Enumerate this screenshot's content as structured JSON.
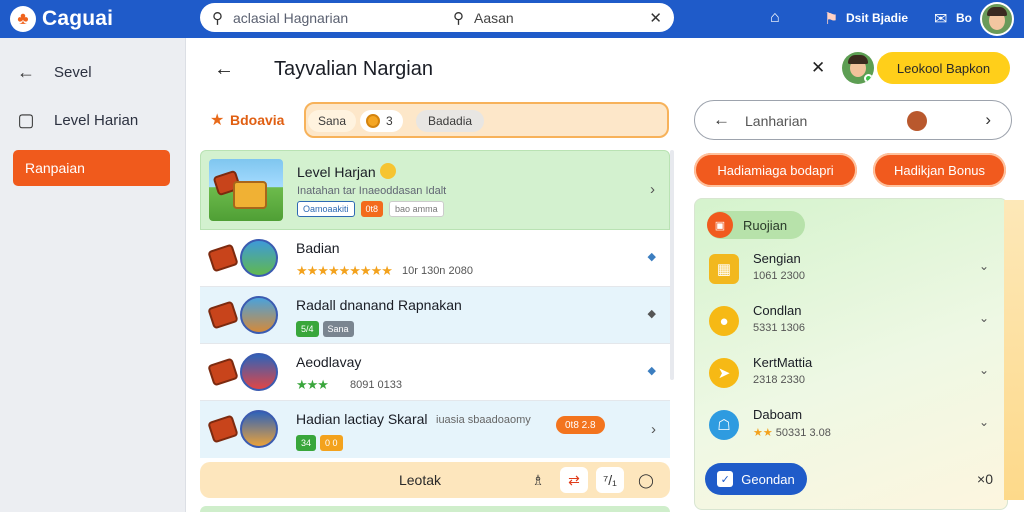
{
  "app": {
    "name": "Caguai",
    "logo_glyph": "♣"
  },
  "search": {
    "hint_left": "aclasial Hagnarian",
    "hint_right": "Aasan",
    "clear_glyph": "✕"
  },
  "topbar": {
    "user_label": "Dsit Bjadie",
    "notif_label": "Bo"
  },
  "sidebar": {
    "items": [
      {
        "label": "Sevel",
        "icon": "arrow-left-icon"
      },
      {
        "label": "Level Harian",
        "icon": "bag-icon"
      }
    ],
    "active": "Ranpaian"
  },
  "main": {
    "title": "Tayvalian Nargian",
    "primary_button": "Leokool Bapkon",
    "filter": {
      "label": "Bdoavia",
      "chips": [
        "Sana",
        "3",
        "Badadia"
      ]
    },
    "list": [
      {
        "title": "Level Harjan",
        "subtitle": "Inatahan tar Inaeoddasan Idalt",
        "tags": [
          "Oamoaakiti",
          "0t8",
          "bao amma"
        ]
      },
      {
        "title": "Badian",
        "rating": "★★★★★★★★★",
        "meta": "10r 130n 2080"
      },
      {
        "title": "Radall dnanand Rapnakan",
        "tags": [
          "5/4",
          "Sana"
        ]
      },
      {
        "title": "Aeodlavay",
        "rating": "★★★",
        "meta": "8091 0133"
      },
      {
        "title": "Hadian lactiay Skaral",
        "note": "iuasia sbaadoaomy",
        "tags": [
          "34",
          "0 0"
        ],
        "pill": "0t8 2.8"
      }
    ],
    "footer": {
      "label": "Leotak",
      "icons": [
        "♗",
        "⇄",
        "⁷/₁",
        "◯"
      ]
    }
  },
  "panel": {
    "search_label": "Lanharian",
    "buttons": [
      "Hadiamiaga bodapri",
      "Hadikjan Bonus"
    ],
    "card": {
      "header": "Ruojian",
      "items": [
        {
          "title": "Sengian",
          "sub": "1061 2300",
          "color": "#f2b81e",
          "icon": "chest-icon"
        },
        {
          "title": "Condlan",
          "sub": "5331 1306",
          "color": "#f6b915",
          "icon": "coin-icon"
        },
        {
          "title": "KertMattia",
          "sub": "2318 2330",
          "color": "#f6b915",
          "icon": "bolt-icon"
        },
        {
          "title": "Daboam",
          "sub": "50331 3.08",
          "color": "#2e9be0",
          "icon": "shield-icon"
        }
      ],
      "action_label": "Geondan",
      "count": "×0"
    }
  },
  "colors": {
    "brand": "#1f5bc9",
    "accent": "#f05a1c",
    "warning": "#ffcf1a"
  }
}
